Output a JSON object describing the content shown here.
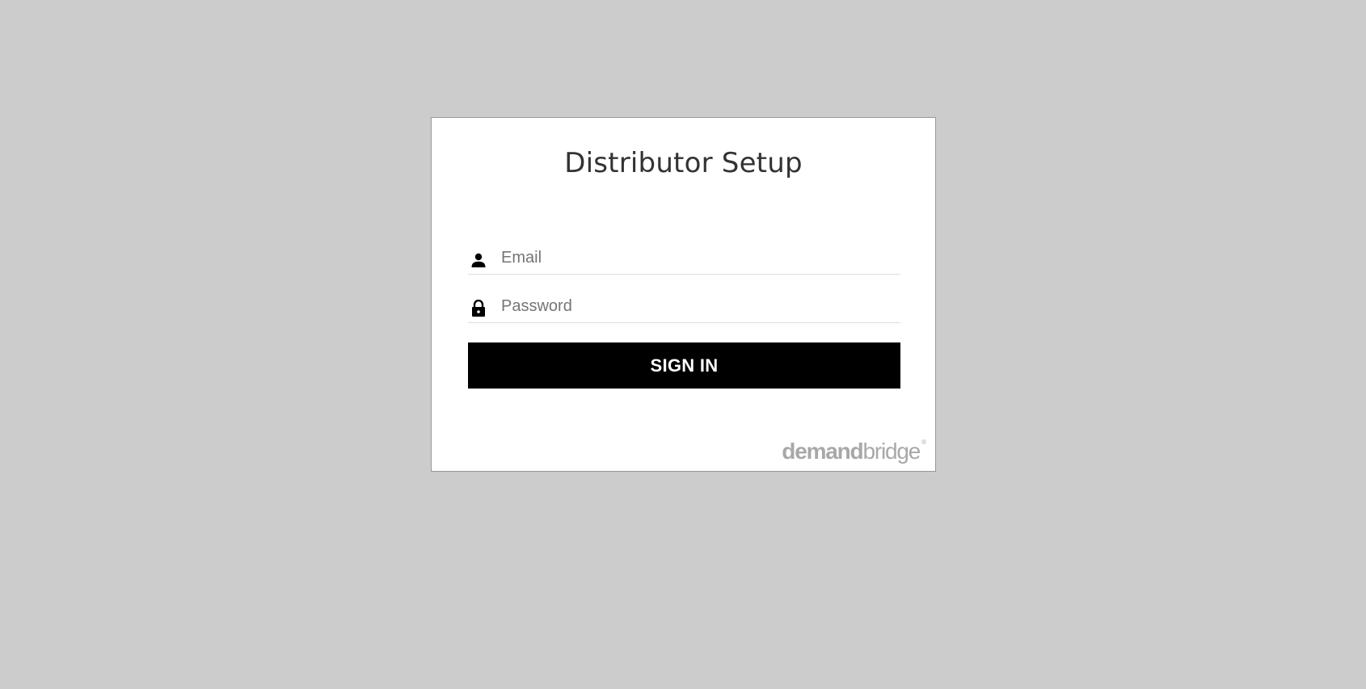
{
  "login": {
    "title": "Distributor Setup",
    "email": {
      "placeholder": "Email",
      "value": "",
      "icon": "person-icon"
    },
    "password": {
      "placeholder": "Password",
      "value": "",
      "icon": "lock-icon"
    },
    "signin_label": "SIGN IN"
  },
  "logo": {
    "bold_part": "demand",
    "light_part": "bridge",
    "registered": "®"
  },
  "colors": {
    "background": "#cccccc",
    "card": "#ffffff",
    "button": "#000000",
    "button_text": "#ffffff",
    "logo": "#a8a8a8"
  }
}
